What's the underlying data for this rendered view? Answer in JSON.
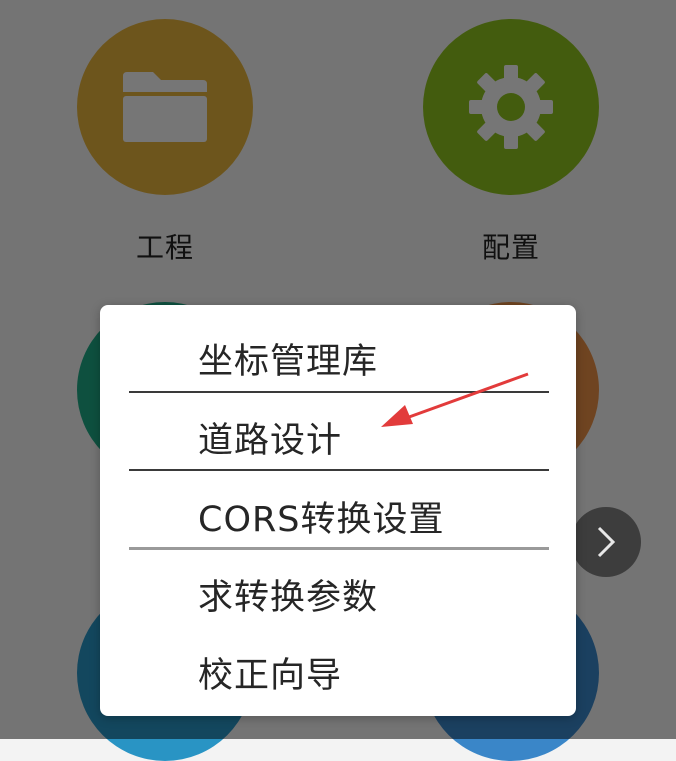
{
  "tiles": {
    "project": {
      "label": "工程",
      "color": "#e4b13b",
      "icon": "folder-icon"
    },
    "config": {
      "label": "配置",
      "color": "#8cc11f",
      "icon": "gear-icon"
    },
    "hidden_left_mid": {
      "color": "#1fa885"
    },
    "hidden_right_mid": {
      "color": "#e98e46"
    },
    "hidden_left_bottom": {
      "color": "#2994c4"
    },
    "hidden_right_bottom": {
      "color": "#3a86c8"
    }
  },
  "menu": {
    "items": [
      {
        "label": "坐标管理库"
      },
      {
        "label": "道路设计"
      },
      {
        "label": "CORS转换设置"
      },
      {
        "label": "求转换参数"
      },
      {
        "label": "校正向导"
      }
    ]
  },
  "next_button": {
    "icon": "chevron-right-icon"
  },
  "annotation": {
    "arrow_color": "#e23b3b"
  }
}
